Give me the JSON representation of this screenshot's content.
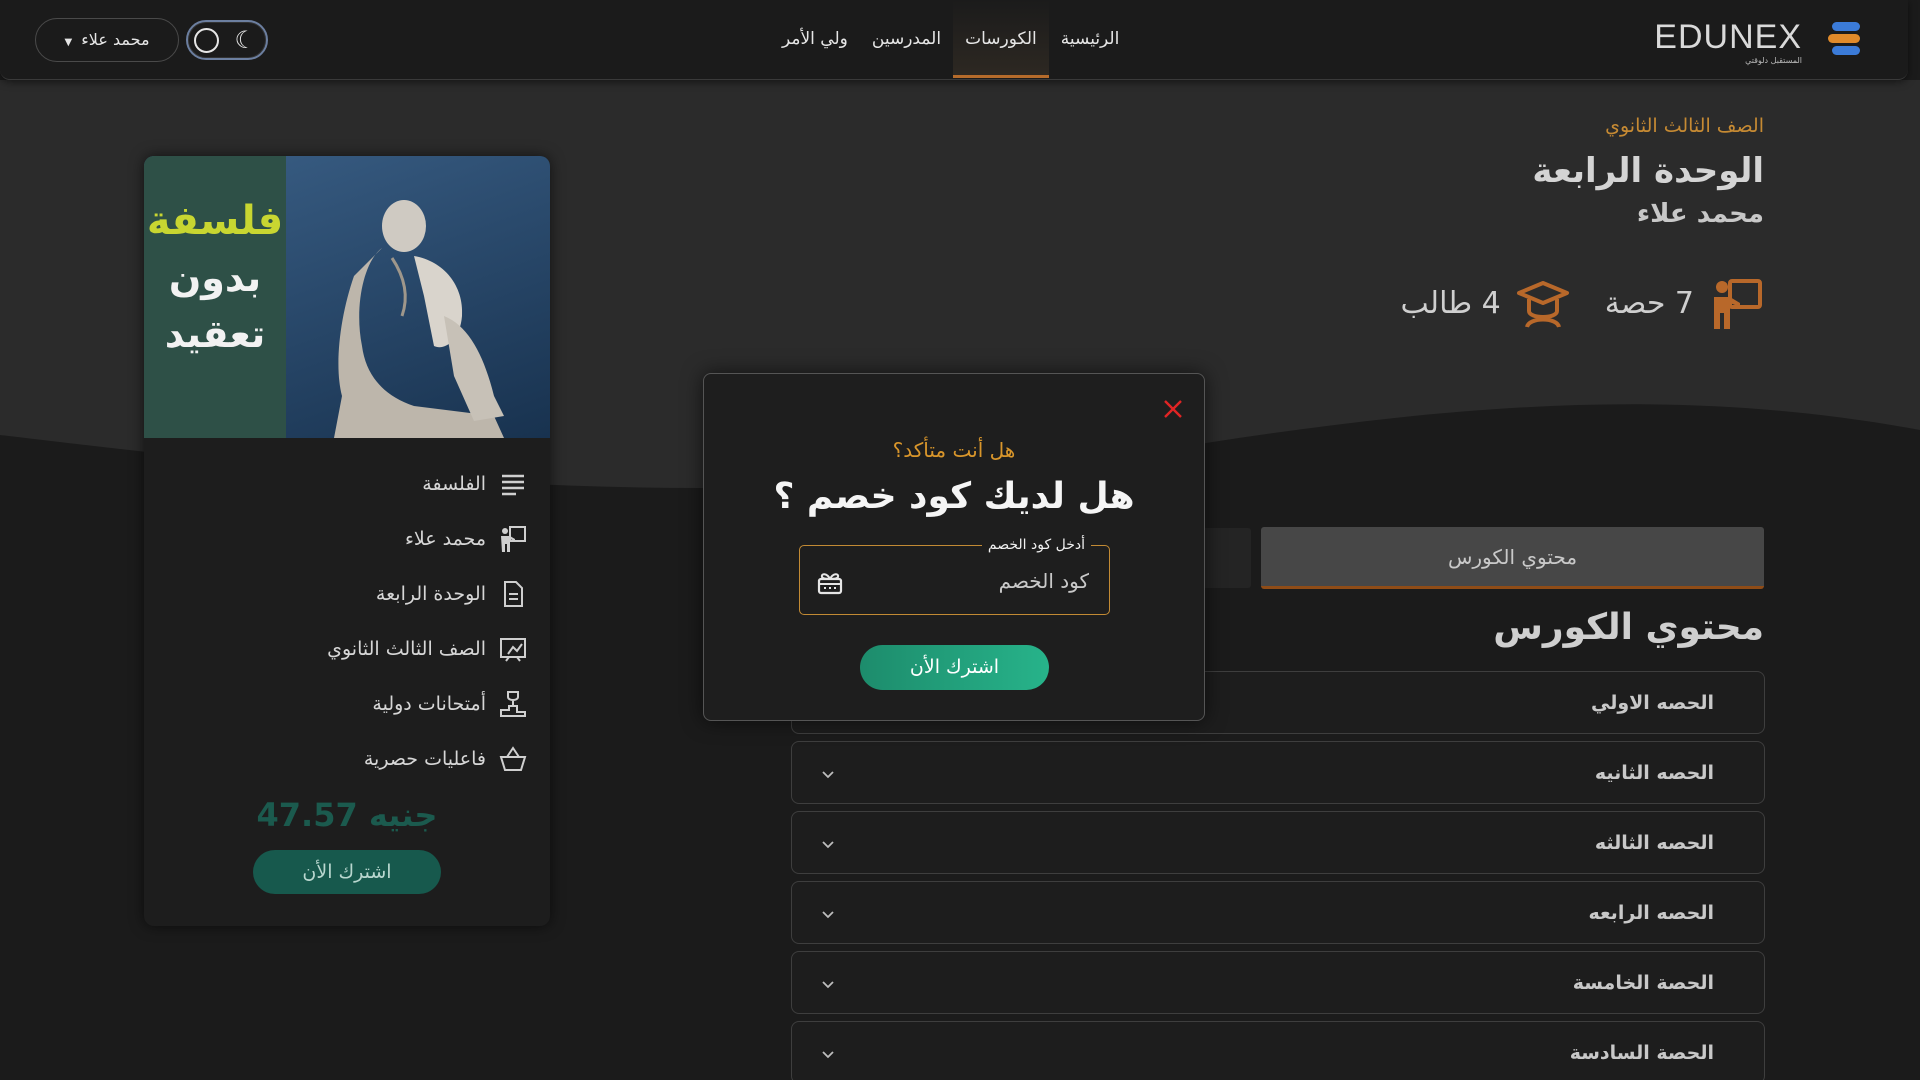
{
  "header": {
    "logo_text": "EDUNEX",
    "logo_subtitle": "المستقبل دلوقتي",
    "nav": [
      {
        "label": "الرئيسية",
        "active": false
      },
      {
        "label": "الكورسات",
        "active": true
      },
      {
        "label": "المدرسين",
        "active": false
      },
      {
        "label": "ولي الأمر",
        "active": false
      }
    ],
    "user_name": "محمد علاء"
  },
  "course": {
    "grade": "الصف الثالث الثانوي",
    "title": "الوحدة الرابعة",
    "teacher": "محمد علاء",
    "lessons_count": "7 حصة",
    "students_count": "4 طالب"
  },
  "card": {
    "cover_words": [
      "فلسفة",
      "بدون",
      "تعقيد"
    ],
    "info": [
      {
        "icon": "lines-icon",
        "text": "الفلسفة"
      },
      {
        "icon": "teacher-icon",
        "text": "محمد علاء"
      },
      {
        "icon": "document-icon",
        "text": "الوحدة الرابعة"
      },
      {
        "icon": "grade-board-icon",
        "text": "الصف الثالث الثانوي"
      },
      {
        "icon": "podium-icon",
        "text": "أمتحانات دولية"
      },
      {
        "icon": "basket-icon",
        "text": "فاعليات حصرية"
      }
    ],
    "price": "47.57 جنيه",
    "subscribe_label": "اشترك الأن"
  },
  "tabs": {
    "content_tab": "محتوي الكورس"
  },
  "content": {
    "title": "محتوي الكورس",
    "lessons": [
      "الحصه الاولي",
      "الحصه الثانيه",
      "الحصه الثالثه",
      "الحصه الرابعه",
      "الحصة الخامسة",
      "الحصة السادسة"
    ]
  },
  "modal": {
    "question": "هل أنت متأكد؟",
    "title": "هل لديك كود خصم ؟",
    "field_label": "أدخل كود الخصم",
    "field_placeholder": "كود الخصم",
    "subscribe_label": "اشترك الأن"
  },
  "colors": {
    "accent_orange": "#c68a33",
    "brand_green": "#27b38a",
    "close_red": "#e02424"
  }
}
